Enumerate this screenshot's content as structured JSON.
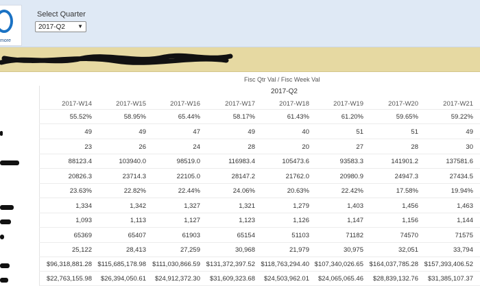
{
  "header": {
    "logo_text": "more",
    "filter_label": "Select Quarter",
    "filter_value": "2017-Q2"
  },
  "pivot": {
    "field_path": "Fisc Qtr Val  /  Fisc Week Val",
    "quarter": "2017-Q2",
    "columns": [
      "2017-W14",
      "2017-W15",
      "2017-W16",
      "2017-W17",
      "2017-W18",
      "2017-W19",
      "2017-W20",
      "2017-W21"
    ],
    "rows": [
      [
        "55.52%",
        "58.95%",
        "65.44%",
        "58.17%",
        "61.43%",
        "61.20%",
        "59.65%",
        "59.22%"
      ],
      [
        "49",
        "49",
        "47",
        "49",
        "40",
        "51",
        "51",
        "49"
      ],
      [
        "23",
        "26",
        "24",
        "28",
        "20",
        "27",
        "28",
        "30"
      ],
      [
        "88123.4",
        "103940.0",
        "98519.0",
        "116983.4",
        "105473.6",
        "93583.3",
        "141901.2",
        "137581.6"
      ],
      [
        "20826.3",
        "23714.3",
        "22105.0",
        "28147.2",
        "21762.0",
        "20980.9",
        "24947.3",
        "27434.5"
      ],
      [
        "23.63%",
        "22.82%",
        "22.44%",
        "24.06%",
        "20.63%",
        "22.42%",
        "17.58%",
        "19.94%"
      ],
      [
        "1,334",
        "1,342",
        "1,327",
        "1,321",
        "1,279",
        "1,403",
        "1,456",
        "1,463"
      ],
      [
        "1,093",
        "1,113",
        "1,127",
        "1,123",
        "1,126",
        "1,147",
        "1,156",
        "1,144"
      ],
      [
        "65369",
        "65407",
        "61903",
        "65154",
        "51103",
        "71182",
        "74570",
        "71575"
      ],
      [
        "25,122",
        "28,413",
        "27,259",
        "30,968",
        "21,979",
        "30,975",
        "32,051",
        "33,794"
      ],
      [
        "$96,318,881.28",
        "$115,685,178.98",
        "$111,030,866.59",
        "$131,372,397.52",
        "$118,763,294.40",
        "$107,340,026.65",
        "$164,037,785.28",
        "$157,393,406.52"
      ],
      [
        "$22,763,155.98",
        "$26,394,050.61",
        "$24,912,372.30",
        "$31,609,323.68",
        "$24,503,962.01",
        "$24,065,065.46",
        "$28,839,132.76",
        "$31,385,107.37"
      ]
    ]
  }
}
